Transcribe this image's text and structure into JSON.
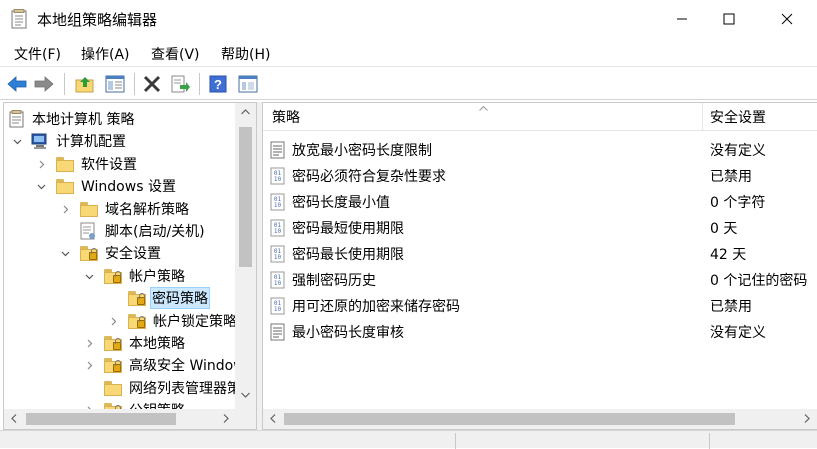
{
  "window": {
    "title": "本地组策略编辑器",
    "controls": [
      "minimize",
      "maximize",
      "close"
    ]
  },
  "menu": {
    "items": [
      "文件(F)",
      "操作(A)",
      "查看(V)",
      "帮助(H)"
    ]
  },
  "toolbar": {
    "buttons": [
      "back-icon",
      "forward-icon",
      "up-folder-icon",
      "show-hide-tree-icon",
      "delete-icon",
      "export-list-icon",
      "help-icon",
      "properties-icon"
    ]
  },
  "tree": {
    "root": "本地计算机 策略",
    "computer_config": "计算机配置",
    "software_settings": "软件设置",
    "windows_settings": "Windows 设置",
    "dns_policy": "域名解析策略",
    "scripts": "脚本(启动/关机)",
    "security_settings": "安全设置",
    "account_policies": "帐户策略",
    "password_policy": "密码策略",
    "lockout_policy": "帐户锁定策略",
    "local_policies": "本地策略",
    "advanced_firewall": "高级安全 Windows Defender 防火墙",
    "network_list": "网络列表管理器策略",
    "partial_item": "公钥策略"
  },
  "list": {
    "columns": [
      "策略",
      "安全设置"
    ],
    "rows": [
      {
        "name": "放宽最小密码长度限制",
        "value": "没有定义",
        "icon": "policy-text-icon"
      },
      {
        "name": "密码必须符合复杂性要求",
        "value": "已禁用",
        "icon": "policy-binary-icon"
      },
      {
        "name": "密码长度最小值",
        "value": "0 个字符",
        "icon": "policy-binary-icon"
      },
      {
        "name": "密码最短使用期限",
        "value": "0 天",
        "icon": "policy-binary-icon"
      },
      {
        "name": "密码最长使用期限",
        "value": "42 天",
        "icon": "policy-binary-icon"
      },
      {
        "name": "强制密码历史",
        "value": "0 个记住的密码",
        "icon": "policy-binary-icon"
      },
      {
        "name": "用可还原的加密来储存密码",
        "value": "已禁用",
        "icon": "policy-binary-icon"
      },
      {
        "name": "最小密码长度审核",
        "value": "没有定义",
        "icon": "policy-text-icon"
      }
    ]
  },
  "colors": {
    "selection_bg": "#cce8ff",
    "selection_border": "#99d1ff",
    "folder": "#f8d775",
    "scrollbar": "#f0f0f0",
    "thumb": "#c2c2c2"
  }
}
